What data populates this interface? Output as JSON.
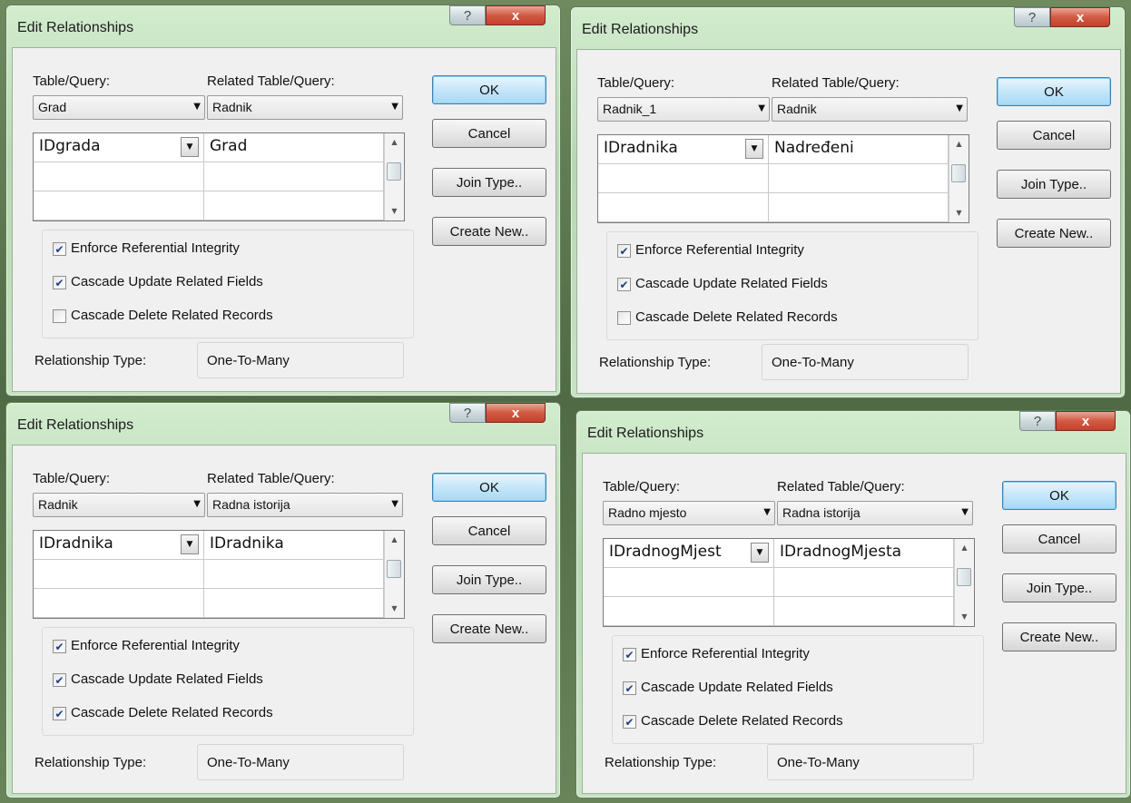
{
  "labels": {
    "table_query": "Table/Query:",
    "related_table_query": "Related Table/Query:",
    "enforce": "Enforce Referential Integrity",
    "cascade_update": "Cascade Update Related Fields",
    "cascade_delete": "Cascade Delete Related Records",
    "relationship_type": "Relationship Type:"
  },
  "buttons": {
    "ok": "OK",
    "cancel": "Cancel",
    "join_type": "Join Type..",
    "create_new": "Create New.."
  },
  "title_buttons": {
    "help": "?",
    "close": "x"
  },
  "colors": {
    "dialog_frame": "#b7d7b2",
    "close_button": "#c4412c",
    "default_button_border": "#3c7fb1",
    "checkmark": "#1c3f86"
  },
  "dialogs": [
    {
      "title": "Edit Relationships",
      "table": "Grad",
      "related_table": "Radnik",
      "field": "IDgrada",
      "related_field": "Grad",
      "enforce_checked": true,
      "cascade_update_checked": true,
      "cascade_delete_checked": false,
      "relationship_type": "One-To-Many"
    },
    {
      "title": "Edit Relationships",
      "table": "Radnik_1",
      "related_table": "Radnik",
      "field": "IDradnika",
      "related_field": "Nadređeni",
      "enforce_checked": true,
      "cascade_update_checked": true,
      "cascade_delete_checked": false,
      "relationship_type": "One-To-Many"
    },
    {
      "title": "Edit Relationships",
      "table": "Radnik",
      "related_table": "Radna istorija",
      "field": "IDradnika",
      "related_field": "IDradnika",
      "enforce_checked": true,
      "cascade_update_checked": true,
      "cascade_delete_checked": true,
      "relationship_type": "One-To-Many"
    },
    {
      "title": "Edit Relationships",
      "table": "Radno mjesto",
      "related_table": "Radna istorija",
      "field": "IDradnogMjest",
      "related_field": "IDradnogMjesta",
      "enforce_checked": true,
      "cascade_update_checked": true,
      "cascade_delete_checked": true,
      "relationship_type": "One-To-Many"
    }
  ]
}
